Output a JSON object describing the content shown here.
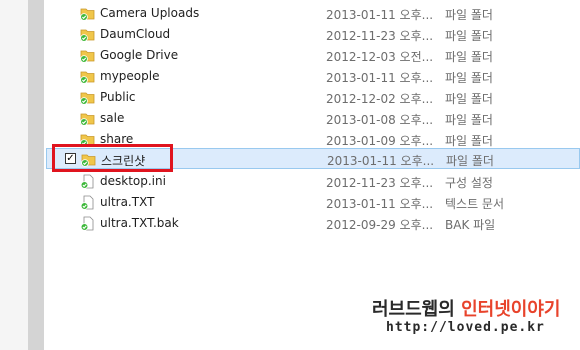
{
  "files": [
    {
      "name": "Camera Uploads",
      "date": "2013-01-11 오후...",
      "type": "파일 폴더",
      "icon": "synced-folder-icon"
    },
    {
      "name": "DaumCloud",
      "date": "2012-11-23 오후...",
      "type": "파일 폴더",
      "icon": "synced-folder-icon"
    },
    {
      "name": "Google Drive",
      "date": "2012-12-03 오전...",
      "type": "파일 폴더",
      "icon": "synced-folder-icon"
    },
    {
      "name": "mypeople",
      "date": "2013-01-11 오후...",
      "type": "파일 폴더",
      "icon": "synced-folder-icon"
    },
    {
      "name": "Public",
      "date": "2012-12-02 오후...",
      "type": "파일 폴더",
      "icon": "synced-folder-icon"
    },
    {
      "name": "sale",
      "date": "2013-01-08 오후...",
      "type": "파일 폴더",
      "icon": "synced-folder-icon"
    },
    {
      "name": "share",
      "date": "2013-01-09 오후...",
      "type": "파일 폴더",
      "icon": "synced-folder-icon"
    },
    {
      "name": "스크린샷",
      "date": "2013-01-11 오후...",
      "type": "파일 폴더",
      "icon": "synced-folder-icon",
      "selected": true,
      "checked": true
    },
    {
      "name": "desktop.ini",
      "date": "2012-11-23 오후...",
      "type": "구성 설정",
      "icon": "synced-file-icon"
    },
    {
      "name": "ultra.TXT",
      "date": "2013-01-11 오후...",
      "type": "텍스트 문서",
      "icon": "synced-file-icon"
    },
    {
      "name": "ultra.TXT.bak",
      "date": "2012-09-29 오후...",
      "type": "BAK 파일",
      "icon": "synced-file-icon"
    }
  ],
  "watermark": {
    "brand_left": "러브드웹의 ",
    "brand_right": "인터넷이야기",
    "url": "http://loved.pe.kr"
  },
  "colors": {
    "selection_bg": "#dcebfc",
    "highlight_border": "#e0141e",
    "folder": "#f0c64a",
    "sync_badge": "#3db83a"
  }
}
